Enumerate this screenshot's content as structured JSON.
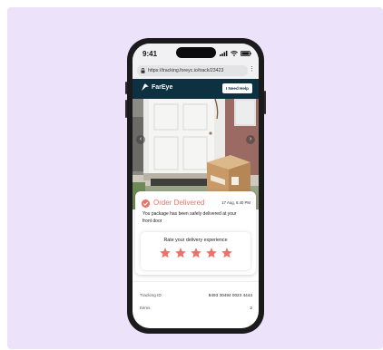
{
  "status_bar": {
    "time": "9:41"
  },
  "browser": {
    "url": "https://tracking.foreyc.io/track/23423"
  },
  "header": {
    "logo_text": "FarEye",
    "help_button": "I Need Help"
  },
  "order": {
    "title": "Order Delivered",
    "date": "17 Aug, 6:40 PM",
    "message": "You package has been safely delivered at your front door"
  },
  "rating": {
    "label": "Rate your delivery experience",
    "stars": 5,
    "star_color": "#e8736a"
  },
  "tracking": {
    "rows": [
      {
        "label": "Tracking ID",
        "value": "8493 30494 0023 4444"
      },
      {
        "label": "Items",
        "value": "2"
      }
    ]
  },
  "colors": {
    "background": "#ece3fb",
    "header": "#0e3141",
    "accent": "#e8736a"
  },
  "icons": [
    "lock-icon",
    "more-icon",
    "signal-icon",
    "wifi-icon",
    "battery-icon",
    "check-icon",
    "star-icon",
    "chevron-left-icon",
    "chevron-right-icon"
  ]
}
